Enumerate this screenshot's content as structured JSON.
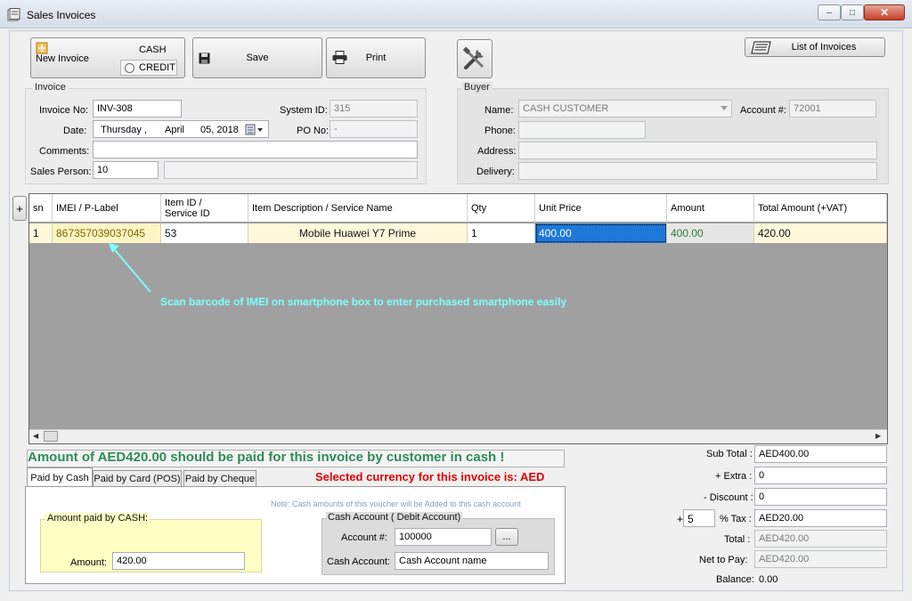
{
  "window": {
    "title": "Sales Invoices",
    "minimize": "–",
    "maximize": "□",
    "close": "✕"
  },
  "toolbar": {
    "new_invoice": "New Invoice",
    "cash_label": "CASH",
    "credit_label": "CREDIT",
    "payment_type_selected": "CASH",
    "save": "Save",
    "print": "Print",
    "list_of_invoices": "List of Invoices"
  },
  "invoice": {
    "group_title": "Invoice",
    "invoice_no_label": "Invoice No:",
    "invoice_no": "INV-308",
    "date_label": "Date:",
    "date_day": "Thursday  ,",
    "date_month": "April",
    "date_rest": "05, 2018",
    "comments_label": "Comments:",
    "comments": "",
    "sales_person_label": "Sales Person:",
    "sales_person": "10",
    "sales_person_name": "",
    "system_id_label": "System ID:",
    "system_id": "315",
    "po_no_label": "PO No:",
    "po_no": "-"
  },
  "buyer": {
    "group_title": "Buyer",
    "name_label": "Name:",
    "name": "CASH CUSTOMER",
    "account_label": "Account #:",
    "account": "72001",
    "phone_label": "Phone:",
    "phone": "",
    "address_label": "Address:",
    "address": "",
    "delivery_label": "Delivery:",
    "delivery": ""
  },
  "grid": {
    "add_button": "+",
    "columns": [
      "sn",
      "IMEI / P-Label",
      "Item ID /\nService ID",
      "Item Description  / Service Name",
      "Qty",
      "Unit Price",
      "Amount",
      "Total Amount (+VAT)"
    ],
    "rows": [
      {
        "sn": "1",
        "imei": "867357039037045",
        "item_id": "53",
        "description": "Mobile Huawei Y7 Prime",
        "qty": "1",
        "unit_price": "400.00",
        "amount": "400.00",
        "total": "420.00"
      }
    ],
    "annotation": "Scan barcode of IMEI on smartphone box to enter purchased smartphone easily"
  },
  "payment": {
    "message": "Amount of AED420.00 should be paid for this invoice by customer in cash !",
    "currency_message": "Selected currency for this invoice is: AED",
    "tabs": [
      "Paid by Cash",
      "Paid by Card (POS)",
      "Paid by Cheque"
    ],
    "note": "Note: Cash amounts of this voucher will be Added to  this cash account",
    "amount_group_title": "Amount paid by CASH:",
    "amount_label": "Amount:",
    "amount": "420.00",
    "cash_account_group_title": "Cash Account ( Debit Account)",
    "account_no_label": "Account #:",
    "account_no": "100000",
    "browse": "...",
    "cash_account_label": "Cash Account:",
    "cash_account_name": "Cash Account name"
  },
  "totals": {
    "sub_total_label": "Sub Total :",
    "sub_total": "AED400.00",
    "extra_label": "+ Extra :",
    "extra": "0",
    "discount_label": "- Discount :",
    "discount": "0",
    "tax_sign": "+",
    "tax_rate": "5",
    "tax_label": "% Tax :",
    "tax": "AED20.00",
    "total_label": "Total :",
    "total": "AED420.00",
    "net_label": "Net to Pay:",
    "net": "AED420.00",
    "balance_label": "Balance:",
    "balance": "0.00"
  },
  "colors": {
    "accent_green": "#2e8b57",
    "currency_red": "#e00000",
    "annotation_cyan": "#7fffff",
    "selected_cell": "#1e78d7"
  }
}
